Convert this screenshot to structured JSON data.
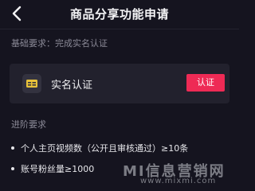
{
  "header": {
    "title": "商品分享功能申请"
  },
  "basic": {
    "title": "基础要求：完成实名认证",
    "card": {
      "label": "实名认证",
      "button": "认证"
    }
  },
  "advanced": {
    "title": "进阶要求",
    "items": [
      "个人主页视频数（公开且审核通过）≥10条",
      "账号粉丝量≥1000"
    ]
  },
  "watermark": {
    "main": "MI信息营销网",
    "url": "www.mixmi.com"
  },
  "colors": {
    "background": "#15141f",
    "card": "#22212d",
    "accent": "#ee2a55",
    "muted_text": "#8b8a97"
  },
  "icons": {
    "back": "chevron-left-icon",
    "id_card": "id-card-icon"
  }
}
